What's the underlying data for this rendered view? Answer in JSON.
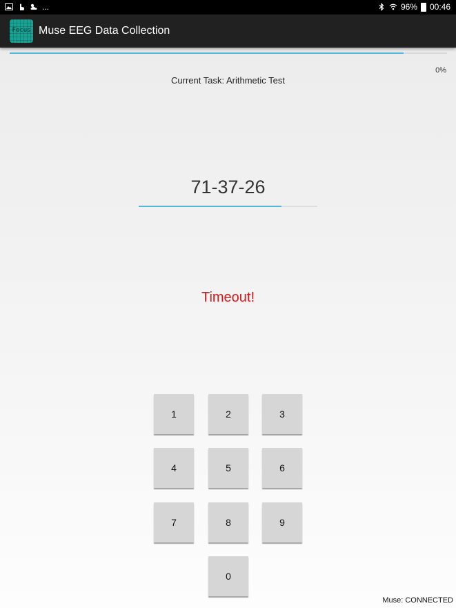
{
  "status_bar": {
    "left_icons": [
      "gallery-icon",
      "hand-icon",
      "weather-icon"
    ],
    "overflow": "...",
    "battery": "96%",
    "time": "00:46"
  },
  "app_bar": {
    "icon_text": "Focus",
    "title": "Muse EEG Data Collection",
    "accent_color": "#1aa394"
  },
  "progress": {
    "percent_label": "0%",
    "bar_fill_fraction": 0.9,
    "bar_color": "#52b7e0"
  },
  "task": {
    "label": "Current Task: Arithmetic Test"
  },
  "problem": {
    "expression": "71-37-26",
    "timer_fill_fraction": 0.8
  },
  "feedback": {
    "text": "Timeout!",
    "color": "#d21a1a"
  },
  "keypad": {
    "keys": [
      "1",
      "2",
      "3",
      "4",
      "5",
      "6",
      "7",
      "8",
      "9",
      "0"
    ]
  },
  "connection": {
    "status": "Muse: CONNECTED"
  }
}
